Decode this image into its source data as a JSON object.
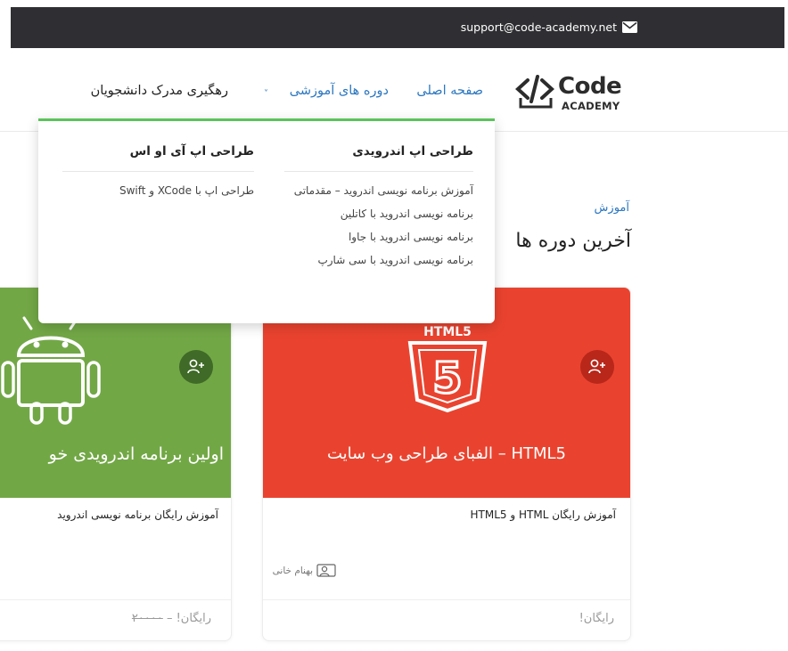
{
  "topbar": {
    "email": "support@code-academy.net",
    "icon": "envelope-icon"
  },
  "logo": {
    "word": "Code",
    "sub": "ACADEMY",
    "icon": "code-tag-icon"
  },
  "nav": {
    "home": "صفحه اصلی",
    "courses": "دوره های آموزشی",
    "chevron": "˅",
    "certificate_tracking": "رهگیری مدرک دانشجویان"
  },
  "dropdown": {
    "android": {
      "title": "طراحی اپ اندرویدی",
      "items": [
        "آموزش برنامه نویسی اندروید – مقدماتی",
        "برنامه نویسی اندروید با کاتلین",
        "برنامه نویسی اندروید با جاوا",
        "برنامه نویسی اندروید با سی شارپ"
      ]
    },
    "ios": {
      "title": "طراحی اپ آی او اس",
      "items": [
        "طراحی اپ با XCode و Swift"
      ]
    }
  },
  "main": {
    "breadcrumb": "آموزش",
    "heading": "آخرین دوره ها"
  },
  "cards": [
    {
      "banner_title": "HTML5 – الفبای طراحی وب سایت",
      "badge": "HTML5",
      "badge_digit": "5",
      "title": "آموزش رایگان HTML و HTML5",
      "author": "بهنام خانی",
      "price": "رایگان!",
      "color": "#e9432f"
    },
    {
      "banner_title": "اولین برنامه اندرویدی خو",
      "title": "آموزش رایگان برنامه نویسی اندروید",
      "old_price": "۲۰۰۰۰",
      "price_sep": " – ",
      "price": "رایگان!",
      "color": "#72a746"
    }
  ],
  "colors": {
    "topbar": "#2f2f33",
    "link": "#2c77c0",
    "dropdown_accent": "#5ac35a"
  }
}
